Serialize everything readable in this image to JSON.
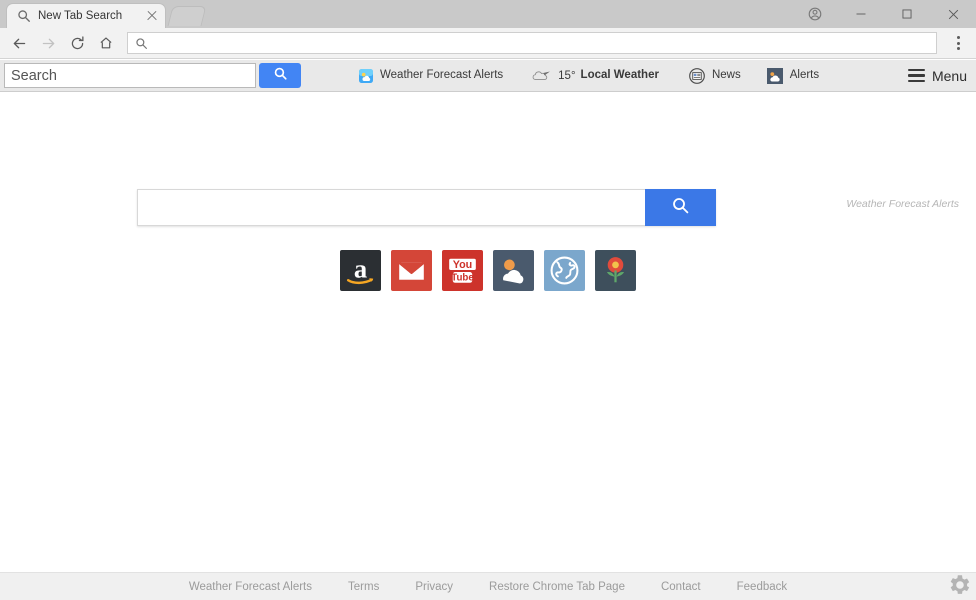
{
  "browser": {
    "tab": {
      "title": "New Tab Search",
      "favicon_icon": "search-icon",
      "close_icon": "close-icon"
    },
    "newtab_button_icon": "new-tab-icon",
    "window_controls": {
      "profile_icon": "profile-avatar-icon",
      "minimize_icon": "minimize-icon",
      "maximize_icon": "maximize-icon",
      "close_icon": "window-close-icon"
    },
    "nav": {
      "back_icon": "arrow-left-icon",
      "forward_icon": "arrow-right-icon",
      "reload_icon": "reload-icon",
      "home_icon": "home-icon",
      "menu_icon": "three-dot-menu-icon",
      "omnibox": {
        "value": "",
        "placeholder": "",
        "icon": "search-icon"
      }
    }
  },
  "extension_bar": {
    "search": {
      "value": "Search",
      "placeholder": "Search",
      "button_icon": "search-icon",
      "button_color": "#4285f4"
    },
    "items": [
      {
        "label": "Weather Forecast Alerts",
        "icon": "weather-app-icon"
      },
      {
        "label": "Local Weather",
        "temperature": "15°",
        "icon": "cloud-icon"
      },
      {
        "label": "News",
        "icon": "newspaper-icon"
      },
      {
        "label": "Alerts",
        "icon": "weather-alert-icon"
      }
    ],
    "menu": {
      "label": "Menu",
      "icon": "hamburger-icon"
    }
  },
  "main": {
    "watermark": "Weather Forecast Alerts",
    "search": {
      "value": "",
      "placeholder": "",
      "button_icon": "search-icon",
      "button_color": "#3b78e7"
    },
    "shortcuts": [
      {
        "name": "Amazon",
        "icon": "amazon-icon",
        "color": "#2b2f33"
      },
      {
        "name": "Gmail",
        "icon": "gmail-icon",
        "color": "#d44638"
      },
      {
        "name": "YouTube",
        "icon": "youtube-icon",
        "color": "#cd332b"
      },
      {
        "name": "Weather",
        "icon": "weather-icon",
        "color": "#4a5a6d"
      },
      {
        "name": "Globe",
        "icon": "globe-icon",
        "color": "#7ba7cc"
      },
      {
        "name": "Flower",
        "icon": "flower-icon",
        "color": "#3e4f5c"
      }
    ]
  },
  "footer": {
    "links": [
      "Weather Forecast Alerts",
      "Terms",
      "Privacy",
      "Restore Chrome Tab Page",
      "Contact",
      "Feedback"
    ],
    "settings_icon": "gear-icon"
  }
}
